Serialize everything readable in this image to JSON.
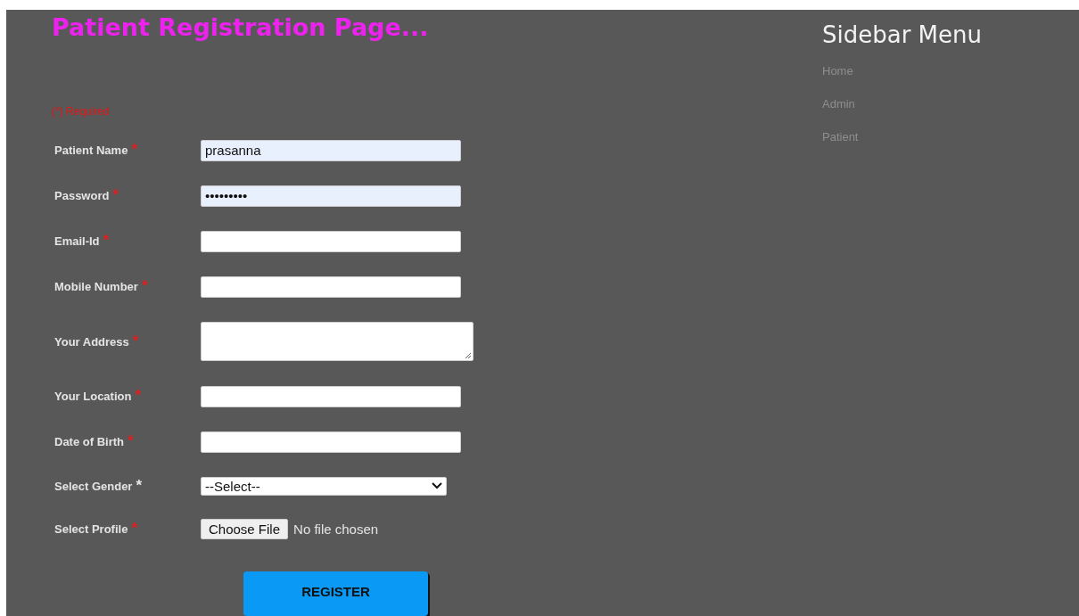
{
  "title": "Patient Registration Page...",
  "required_note": "(*) Required",
  "fields": [
    {
      "kind": "text",
      "label": "Patient Name",
      "asterisk": "*",
      "color": "#e02020",
      "value": "prasanna",
      "autofilled": true
    },
    {
      "kind": "text",
      "label": "Password",
      "asterisk": "*",
      "color": "#e02020",
      "value": "•••••••••",
      "autofilled": true
    },
    {
      "kind": "text",
      "label": "Email-Id",
      "asterisk": "*",
      "color": "#e02020",
      "autofilled": false
    },
    {
      "kind": "text",
      "label": "Mobile Number",
      "asterisk": "*",
      "color": "#e02020",
      "autofilled": false
    },
    {
      "kind": "textarea",
      "label": "Your Address",
      "asterisk": "*",
      "color": "#e02020"
    },
    {
      "kind": "text",
      "label": "Your Location",
      "asterisk": "*",
      "color": "#e02020",
      "autofilled": false
    },
    {
      "kind": "text",
      "label": "Date of Birth",
      "asterisk": "*",
      "color": "#e02020",
      "autofilled": false
    },
    {
      "kind": "select",
      "label": "Select Gender",
      "asterisk": "*",
      "color": "#e8e8e8",
      "value": "--Select--"
    },
    {
      "kind": "file",
      "label": "Select Profile",
      "asterisk": "*",
      "color": "#e02020",
      "button": "Choose File",
      "status": "No file chosen"
    }
  ],
  "submit": "REGISTER",
  "sidebar": {
    "title": "Sidebar Menu",
    "items": [
      "Home",
      "Admin",
      "Patient"
    ]
  }
}
